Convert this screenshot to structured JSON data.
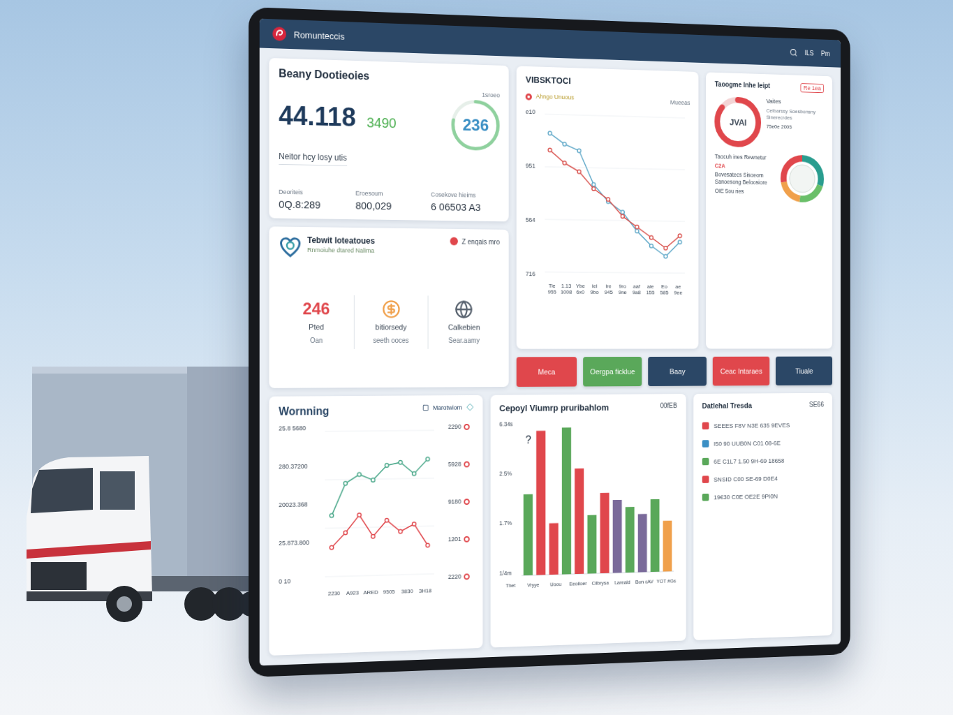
{
  "header": {
    "title": "Romunteccis",
    "links": [
      "ILS",
      "Pm"
    ]
  },
  "summary": {
    "title": "Beany Dootieoies",
    "value": "44.118",
    "delta": "3490",
    "caption": "1sroeo",
    "ring": {
      "value": "236",
      "level": 0.78
    },
    "subtitle": "Neitor hcy losy utis",
    "stats": [
      {
        "label": "Deoriteis",
        "value": "0Q.8:289"
      },
      {
        "label": "Eroesoum",
        "value": "800,029"
      },
      {
        "label": "Cosekove hieims",
        "value": "6 06503 A3"
      }
    ]
  },
  "fleet": {
    "title": "Tebwit Ioteatoues",
    "subtitle": "Rnmoiuhe dtared Nalima",
    "status": "Z enqais mro",
    "items": [
      {
        "kind": "number",
        "value": "246",
        "label": "Pted",
        "note": "Oan"
      },
      {
        "kind": "coin",
        "label": "bitiorsedy",
        "note": "seeth ooces"
      },
      {
        "kind": "globe",
        "label": "Calkebien",
        "note": "Sear.aamy"
      }
    ]
  },
  "trend": {
    "title": "VIBSKTOCI",
    "legend": "Ahngo Unuous",
    "note": "Mueeas",
    "y_ticks": [
      "e10",
      "951",
      "564",
      "716"
    ],
    "x_labels": [
      {
        "top": "Tie",
        "bottom": "955"
      },
      {
        "top": "1.13",
        "bottom": "1008"
      },
      {
        "top": "Ybe",
        "bottom": "6x0"
      },
      {
        "top": "Iel",
        "bottom": "9bo"
      },
      {
        "top": "lre",
        "bottom": "945"
      },
      {
        "top": "9ro",
        "bottom": "9ne"
      },
      {
        "top": "aaf",
        "bottom": "9a8"
      },
      {
        "top": "aie",
        "bottom": "155"
      },
      {
        "top": "Eo",
        "bottom": "585"
      },
      {
        "top": "ae",
        "bottom": "9ee"
      }
    ],
    "series": [
      {
        "color": "#5fa8c8",
        "values": [
          960,
          910,
          880,
          720,
          640,
          590,
          500,
          430,
          380,
          450
        ]
      },
      {
        "color": "#d9534f",
        "values": [
          880,
          820,
          780,
          700,
          650,
          570,
          520,
          470,
          420,
          480
        ]
      }
    ]
  },
  "ratio": {
    "title": "Taoogme Inhe Ieipt",
    "badge": "Re 1ea",
    "ring": {
      "label": "JVAI",
      "level": 0.86
    },
    "side_title": "Vaites",
    "side_text": "Celbarssy Soesbonsny Sinerecrdes",
    "side_value": "75e0e 2005",
    "notes": [
      {
        "text": "Taocuh ines Rewnetur",
        "alert": false
      },
      {
        "text": "C2A",
        "alert": true
      },
      {
        "text": "Bovesatecs Sisoeom Sanoesong Beloosiore",
        "alert": false
      },
      {
        "text": "OIE 5ou ries",
        "alert": false
      }
    ],
    "segments": [
      {
        "share": 0.3,
        "color": "#2a9d8f"
      },
      {
        "share": 0.22,
        "color": "#6abf69"
      },
      {
        "share": 0.2,
        "color": "#f0a04b"
      },
      {
        "share": 0.28,
        "color": "#e0474c"
      }
    ]
  },
  "actions": [
    {
      "label": "Meca",
      "color": "#e0474c"
    },
    {
      "label": "Oergpa ficklue",
      "color": "#5aa85a"
    },
    {
      "label": "Baay",
      "color": "#2b4766"
    },
    {
      "label": "Ceac Intaraes",
      "color": "#e0474c"
    },
    {
      "label": "Tiuale",
      "color": "#2b4766"
    }
  ],
  "warning": {
    "title": "Wornning",
    "tool": "Marotwiorn",
    "y_ticks": [
      "25.8 5680",
      "280.37200",
      "20023.368",
      "25.873.800",
      "0 10"
    ],
    "right_marks": [
      {
        "label": "2290",
        "color": "#e0474c"
      },
      {
        "label": "5928",
        "color": "#e0474c"
      },
      {
        "label": "9180",
        "color": "#e0474c"
      },
      {
        "label": "1201",
        "color": "#e0474c"
      },
      {
        "label": "2220",
        "color": "#e0474c"
      }
    ],
    "x_labels": [
      "2230",
      "A923",
      "ARED",
      "9505",
      "3830",
      "3H18"
    ],
    "series": [
      {
        "color": "#4aa88a",
        "values": [
          420,
          640,
          700,
          660,
          760,
          780,
          700,
          800
        ]
      },
      {
        "color": "#e0474c",
        "values": [
          200,
          300,
          420,
          270,
          380,
          300,
          350,
          200
        ]
      }
    ]
  },
  "bars": {
    "title": "Cepoyl Viumrp pruribahlom",
    "note": "00fEB",
    "mark": "?",
    "y_ticks": [
      "6.34s",
      "2.5%",
      "1.7%",
      "1/4m"
    ],
    "x_labels": [
      "Thet",
      "Vryye",
      "Uoou",
      "Eeoiloer",
      "Cilbrysa",
      "Lareald",
      "Bun cAV",
      "YOT #Gs"
    ],
    "bars": [
      {
        "value": 55,
        "color": "#5aa85a"
      },
      {
        "value": 98,
        "color": "#e0474c"
      },
      {
        "value": 35,
        "color": "#e0474c"
      },
      {
        "value": 100,
        "color": "#5aa85a"
      },
      {
        "value": 72,
        "color": "#e0474c"
      },
      {
        "value": 40,
        "color": "#5aa85a"
      },
      {
        "value": 55,
        "color": "#e0474c"
      },
      {
        "value": 50,
        "color": "#7a6a9a"
      },
      {
        "value": 45,
        "color": "#5aa85a"
      },
      {
        "value": 40,
        "color": "#7a6a9a"
      },
      {
        "value": 50,
        "color": "#5aa85a"
      },
      {
        "value": 35,
        "color": "#f0a04b"
      }
    ]
  },
  "details": {
    "title": "Datlehal Tresda",
    "note": "SE66",
    "rows": [
      {
        "text": "SEEES F8V N3E 635 9EVES",
        "color": "#e0474c"
      },
      {
        "text": "I50 90 UUB0N C01 08-6E",
        "color": "#3b8fc4"
      },
      {
        "text": "6E C1L7 1.50 9H-69 18658",
        "color": "#5aa85a"
      },
      {
        "text": "SNSID C00 SE-69 D0E4",
        "color": "#e0474c"
      },
      {
        "text": "19€30 C0E OE2E 9PI0N",
        "color": "#5aa85a"
      }
    ]
  }
}
